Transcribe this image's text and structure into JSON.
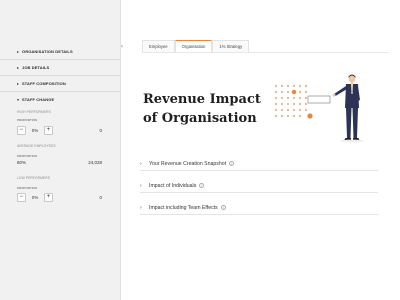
{
  "sidebar": {
    "sections": {
      "organisation_details": "ORGANISATION DETAILS",
      "job_details": "JOB DETAILS",
      "staff_composition": "STAFF COMPOSITION",
      "staff_change": "STAFF CHANGE"
    },
    "groups": [
      {
        "title": "HIGH PERFORMERS",
        "proportion_label": "PROPORTION",
        "value": "0%",
        "number": "0",
        "has_stepper": true
      },
      {
        "title": "AVERAGE EMPLOYEES",
        "proportion_label": "PROPORTION",
        "value": "80%",
        "number": "24,028",
        "has_stepper": false
      },
      {
        "title": "LOW PERFORMERS",
        "proportion_label": "PROPORTION",
        "value": "0%",
        "number": "0",
        "has_stepper": true
      }
    ],
    "stepper": {
      "minus": "−",
      "plus": "+"
    },
    "collapse_icon": "‹"
  },
  "tabs": [
    "Employee",
    "Organisation",
    "1% Strategy"
  ],
  "active_tab": "Organisation",
  "main": {
    "title_line1": "Revenue Impact",
    "title_line2": "of Organisation",
    "accordions": [
      {
        "label": "Your Revenue Creation Snapshot",
        "info": true
      },
      {
        "label": "Impact of Individuals",
        "info": true
      },
      {
        "label": "Impact including Team Effects",
        "info": true
      }
    ],
    "info_icon": "i",
    "chevron_icon": "›"
  },
  "colors": {
    "accent": "#e8863a",
    "sidebar_bg": "#f1f1f1",
    "suit": "#2d3354"
  }
}
